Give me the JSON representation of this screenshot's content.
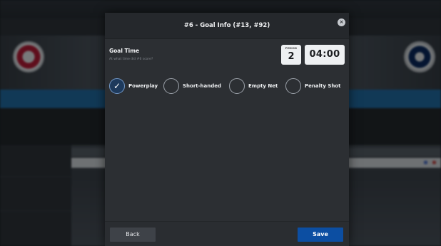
{
  "modal": {
    "title": "#6 - Goal Info (#13, #92)",
    "close_glyph": "×",
    "goal_time": {
      "label": "Goal Time",
      "sublabel": "At what time did #6 score?",
      "period_label": "PERIOD",
      "period_value": "2",
      "time_value": "04:00"
    },
    "options": [
      {
        "label": "Powerplay",
        "checked": true
      },
      {
        "label": "Short-handed",
        "checked": false
      },
      {
        "label": "Empty Net",
        "checked": false
      },
      {
        "label": "Penalty Shot",
        "checked": false
      }
    ],
    "footer": {
      "back_label": "Back",
      "save_label": "Save"
    }
  },
  "icons": {
    "close": "close-icon",
    "check": "check-icon"
  },
  "colors": {
    "save_button": "#0c4ea2",
    "modal_bg": "#2c2f33",
    "header_blue": "#1c6fae"
  }
}
